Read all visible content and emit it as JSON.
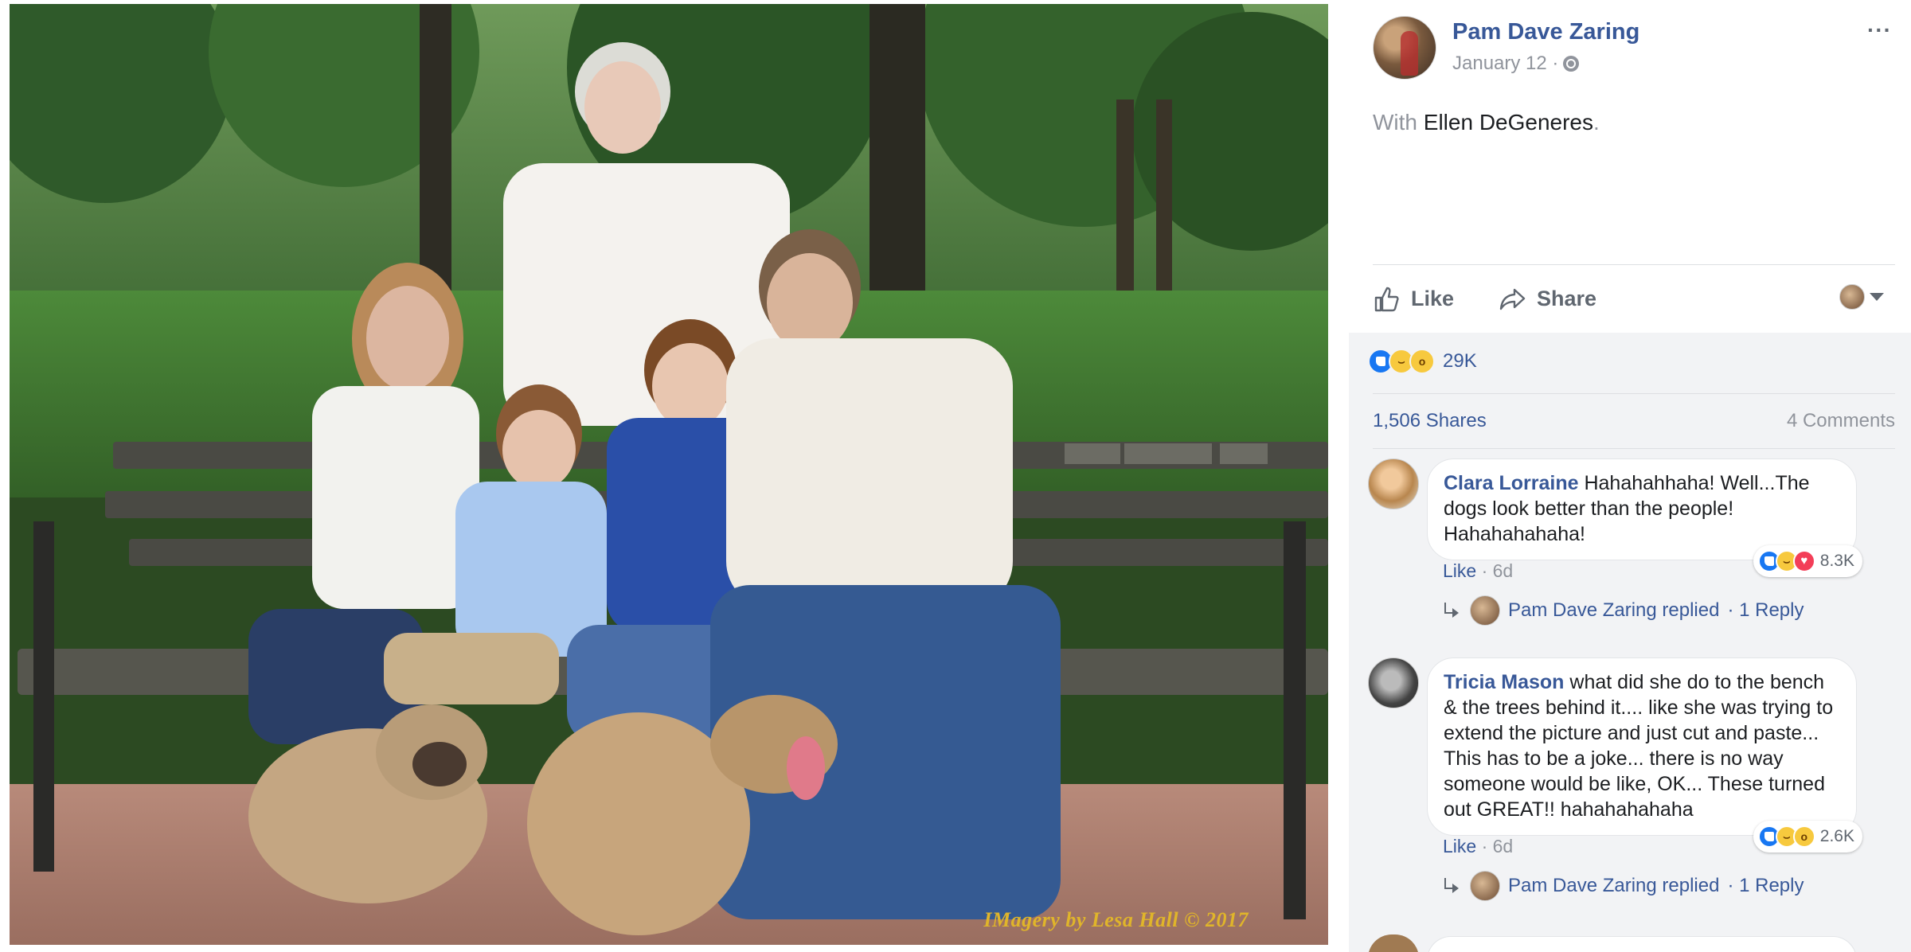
{
  "photo": {
    "watermark": "IMagery by Lesa Hall  ©  2017"
  },
  "post": {
    "author": "Pam Dave Zaring",
    "date": "January 12 ·",
    "privacy_icon": "globe-icon",
    "more_label": "···",
    "with_label": "With",
    "tagged": "Ellen DeGeneres",
    "period": "."
  },
  "actions": {
    "like_label": "Like",
    "share_label": "Share"
  },
  "feedback": {
    "reactions": [
      "like",
      "haha",
      "wow"
    ],
    "reaction_count": "29K",
    "shares": "1,506 Shares",
    "comments": "4 Comments"
  },
  "comments": [
    {
      "name": "Clara Lorraine",
      "text": "Hahahahhaha! Well...The dogs look better than the people! Hahahahahaha!",
      "reactions": [
        "like",
        "haha",
        "love"
      ],
      "reaction_count": "8.3K",
      "like_label": "Like",
      "time": "· 6d",
      "reply_author": "Pam Dave Zaring replied",
      "reply_count": "· 1 Reply"
    },
    {
      "name": "Tricia Mason",
      "text": "what did she do to the bench & the trees behind it.... like she was trying to extend the picture and just cut and paste... This has to be a joke... there is no way someone would be like, OK... These turned out GREAT!! hahahahahaha",
      "reactions": [
        "like",
        "haha",
        "wow"
      ],
      "reaction_count": "2.6K",
      "like_label": "Like",
      "time": "· 6d",
      "reply_author": "Pam Dave Zaring replied",
      "reply_count": "· 1 Reply"
    }
  ],
  "colors": {
    "link": "#385898",
    "muted": "#90949c",
    "feedback_bg": "#f2f3f5",
    "watermark": "#e0b52a"
  }
}
